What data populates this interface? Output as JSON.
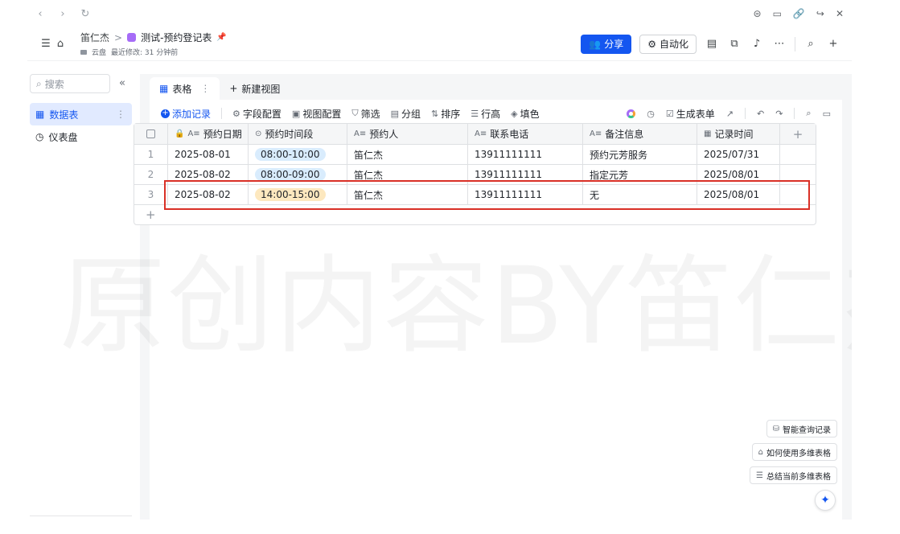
{
  "browser": {
    "back": "‹",
    "forward": "›",
    "reload": "↻",
    "right_icons": [
      "⊜",
      "▭",
      "🔗",
      "↪",
      "✕"
    ]
  },
  "titlebar": {
    "owner": "笛仁杰",
    "separator": ">",
    "title": "测试-预约登记表",
    "location": "云盘",
    "modified": "最近修改: 31 分钟前",
    "share_label": "分享",
    "automation_label": "自动化"
  },
  "sidebar": {
    "search_placeholder": "搜索",
    "items": [
      {
        "label": "数据表",
        "active": true
      },
      {
        "label": "仪表盘",
        "active": false
      }
    ]
  },
  "views": {
    "active_tab": "表格",
    "new_view": "新建视图"
  },
  "toolbar": {
    "add_record": "添加记录",
    "items": [
      "字段配置",
      "视图配置",
      "筛选",
      "分组",
      "排序",
      "行高",
      "填色"
    ],
    "generate_form": "生成表单"
  },
  "table": {
    "columns": [
      "预约日期",
      "预约时间段",
      "预约人",
      "联系电话",
      "备注信息",
      "记录时间"
    ],
    "rows": [
      {
        "index": "1",
        "date": "2025-08-01",
        "slot": "08:00-10:00",
        "slot_color": "blue",
        "person": "笛仁杰",
        "phone": "13911111111",
        "note": "预约元芳服务",
        "recorded": "2025/07/31"
      },
      {
        "index": "2",
        "date": "2025-08-02",
        "slot": "08:00-09:00",
        "slot_color": "blue",
        "person": "笛仁杰",
        "phone": "13911111111",
        "note": "指定元芳",
        "recorded": "2025/08/01"
      },
      {
        "index": "3",
        "date": "2025-08-02",
        "slot": "14:00-15:00",
        "slot_color": "orange",
        "person": "笛仁杰",
        "phone": "13911111111",
        "note": "无",
        "recorded": "2025/08/01"
      }
    ]
  },
  "watermark": "原创内容BY笛仁杰",
  "helpers": [
    "智能查询记录",
    "如何使用多维表格",
    "总结当前多维表格"
  ],
  "colors": {
    "accent": "#1456f0",
    "highlight": "#d93026"
  }
}
